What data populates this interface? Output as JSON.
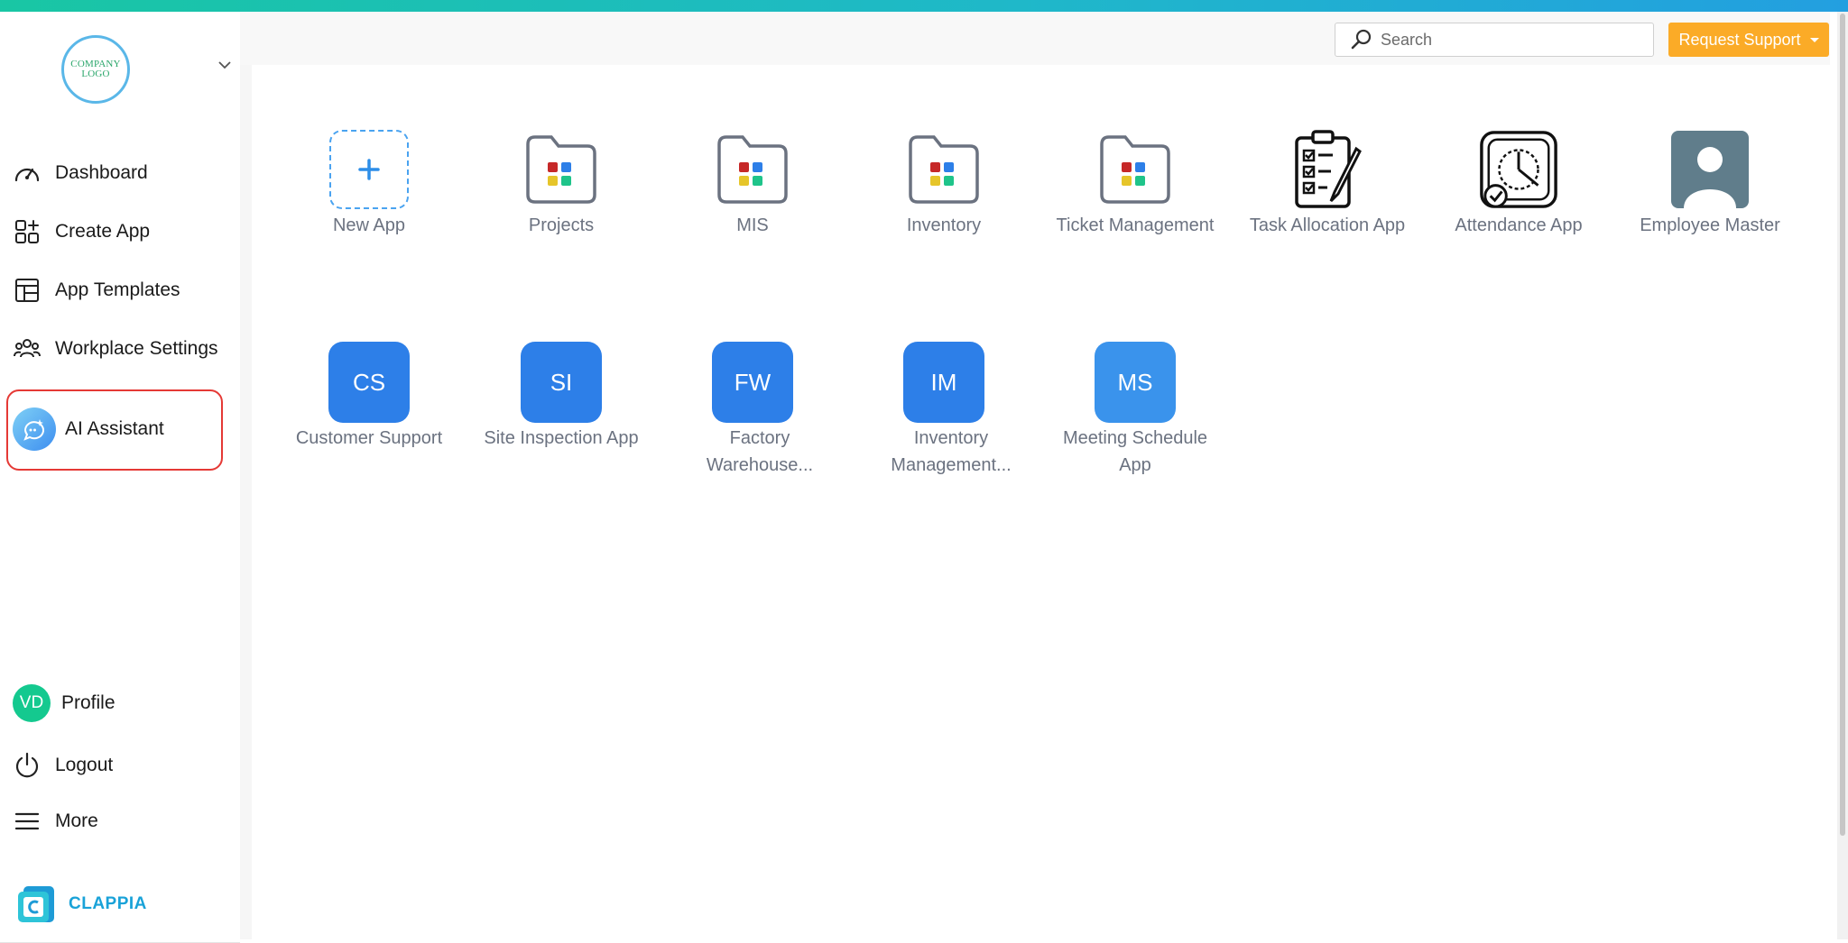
{
  "colors": {
    "accent_gradient_start": "#19c6a4",
    "accent_gradient_end": "#239fe0",
    "support_button": "#fbab27",
    "app_tile_blue": "#2d7fe8",
    "app_tile_light_blue": "#3a93ec",
    "highlight_border": "#e53935",
    "profile_avatar": "#14c98f",
    "brand_text": "#19a2d8"
  },
  "sidebar": {
    "logo_text_line1": "COMPANY",
    "logo_text_line2": "LOGO",
    "nav": [
      {
        "label": "Dashboard",
        "icon": "gauge-icon"
      },
      {
        "label": "Create App",
        "icon": "grid-plus-icon"
      },
      {
        "label": "App Templates",
        "icon": "layout-template-icon"
      },
      {
        "label": "Workplace Settings",
        "icon": "users-group-icon"
      }
    ],
    "ai_assistant": {
      "label": "AI Assistant",
      "icon": "ai-chat-icon"
    },
    "profile": {
      "initials": "VD",
      "label": "Profile"
    },
    "logout": {
      "label": "Logout",
      "icon": "power-icon"
    },
    "more": {
      "label": "More",
      "icon": "menu-icon"
    },
    "brand": {
      "name": "CLAPPIA",
      "icon": "clappia-logo-icon"
    }
  },
  "header": {
    "search_placeholder": "Search",
    "support_button": "Request Support"
  },
  "apps_row1": [
    {
      "label": "New App",
      "icon": "plus-icon",
      "kind": "new"
    },
    {
      "label": "Projects",
      "icon": "folder-apps-icon",
      "kind": "folder"
    },
    {
      "label": "MIS",
      "icon": "folder-apps-icon",
      "kind": "folder"
    },
    {
      "label": "Inventory",
      "icon": "folder-apps-icon",
      "kind": "folder"
    },
    {
      "label": "Ticket Management",
      "icon": "folder-apps-icon",
      "kind": "folder"
    },
    {
      "label": "Task Allocation App",
      "icon": "clipboard-checklist-icon",
      "kind": "image"
    },
    {
      "label": "Attendance App",
      "icon": "clock-check-icon",
      "kind": "image"
    },
    {
      "label": "Employee Master",
      "icon": "person-icon",
      "kind": "image"
    }
  ],
  "apps_row2": [
    {
      "initials": "CS",
      "label": "Customer Support"
    },
    {
      "initials": "SI",
      "label": "Site Inspection App"
    },
    {
      "initials": "FW",
      "label": "Factory Warehouse..."
    },
    {
      "initials": "IM",
      "label": "Inventory Management..."
    },
    {
      "initials": "MS",
      "label": "Meeting Schedule App"
    }
  ]
}
